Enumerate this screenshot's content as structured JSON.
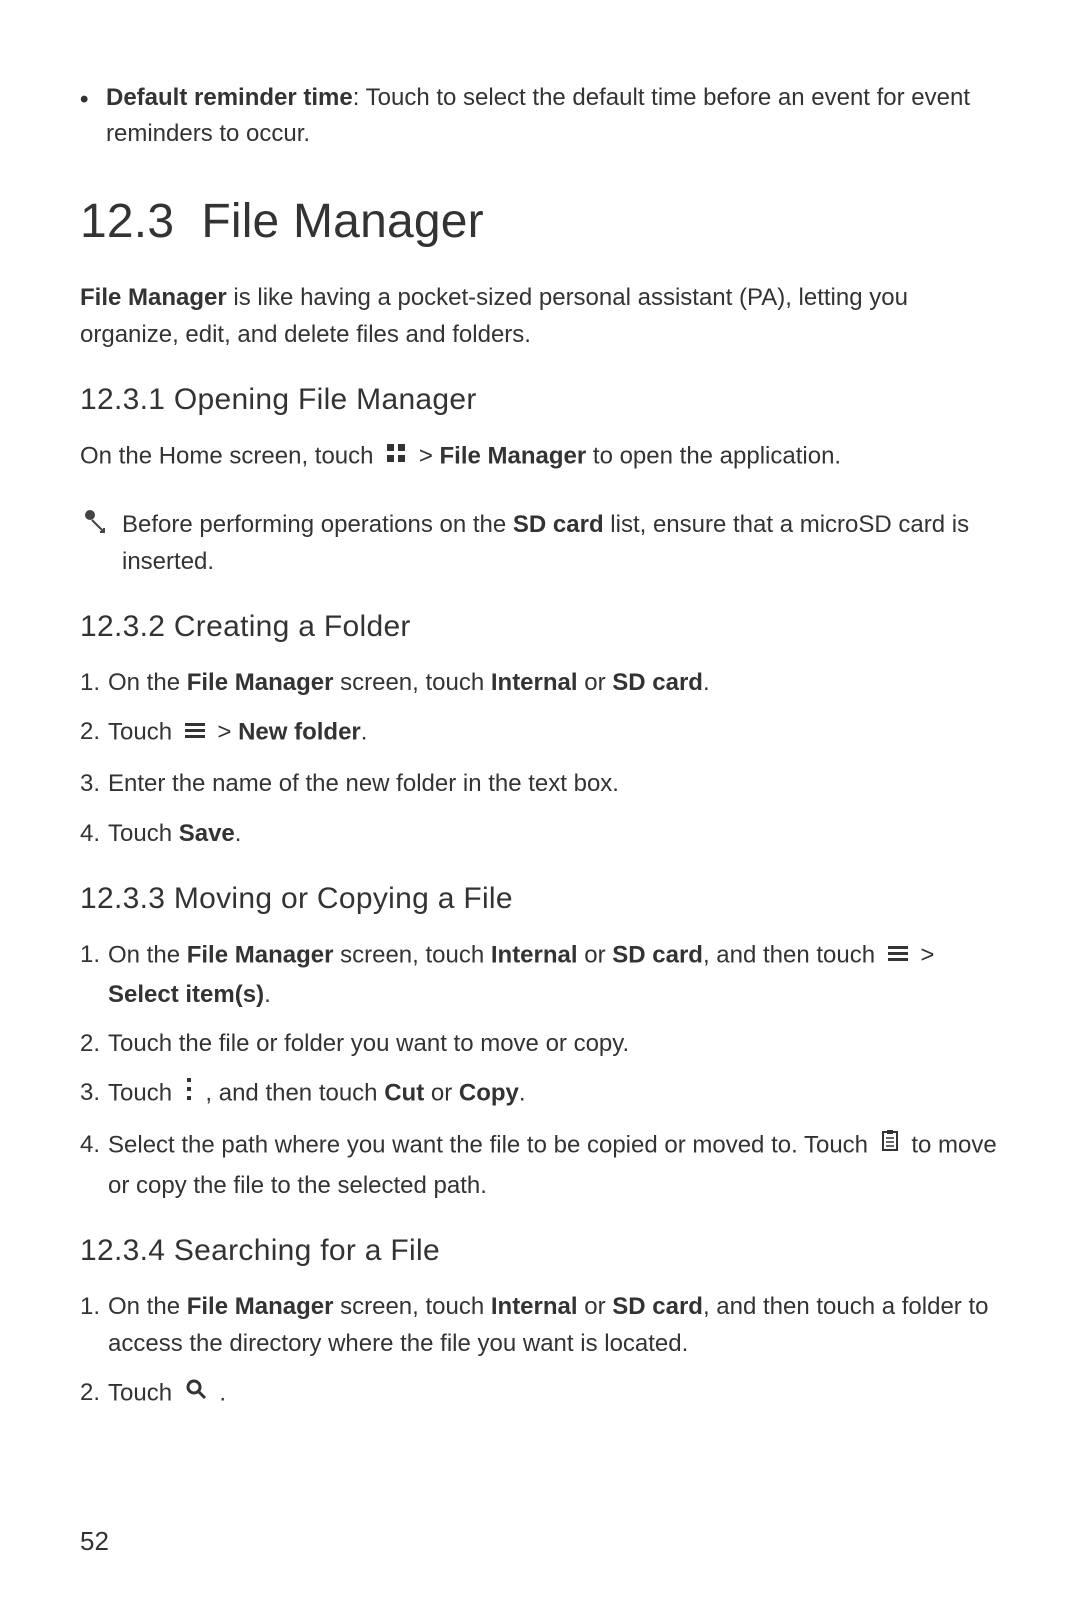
{
  "intro_bullet": {
    "label": "Default reminder time",
    "text": ": Touch to select the default time before an event for event reminders to occur."
  },
  "section": {
    "number": "12.3",
    "title": "File Manager"
  },
  "intro_para": {
    "file_manager": "File Manager",
    "rest": " is like having a pocket-sized personal assistant (PA), letting you organize, edit, and delete files and folders."
  },
  "s1": {
    "heading": "12.3.1  Opening File Manager",
    "line_pre": "On the Home screen, touch ",
    "chevron_post": " > ",
    "file_manager": "File Manager",
    "line_post": " to open the application.",
    "note_pre": "Before performing operations on the ",
    "sd_card": "SD card",
    "note_post": " list, ensure that a microSD card is inserted."
  },
  "s2": {
    "heading": "12.3.2  Creating a Folder",
    "step1_pre": "On the ",
    "fm": "File Manager",
    "step1_mid": " screen, touch ",
    "internal": "Internal",
    "or": " or ",
    "sd": "SD card",
    "step1_post": ".",
    "step2_pre": "Touch ",
    "step2_chev": " > ",
    "new_folder": "New folder",
    "step2_post": ".",
    "step3": "Enter the name of the new folder in the text box.",
    "step4_pre": "Touch ",
    "save": "Save",
    "step4_post": "."
  },
  "s3": {
    "heading": "12.3.3  Moving or Copying a File",
    "step1_pre": "On the ",
    "fm": "File Manager",
    "step1_mid": " screen, touch ",
    "internal": "Internal",
    "or": " or ",
    "sd": "SD card",
    "step1_post1": ", and then touch ",
    "step1_chev": " > ",
    "select_items": "Select item(s)",
    "step1_post2": ".",
    "step2": "Touch the file or folder you want to move or copy.",
    "step3_pre": "Touch ",
    "step3_mid": " , and then touch ",
    "cut": "Cut",
    "or2": " or ",
    "copy": "Copy",
    "step3_post": ".",
    "step4_pre": "Select the path where you want the file to be copied or moved to. Touch ",
    "step4_post": " to move or copy the file to the selected path."
  },
  "s4": {
    "heading": "12.3.4  Searching for a File",
    "step1_pre": "On the ",
    "fm": "File Manager",
    "step1_mid": " screen, touch ",
    "internal": "Internal",
    "or": " or ",
    "sd": "SD card",
    "step1_post": ", and then touch a folder to access the directory where the file you want is located.",
    "step2_pre": "Touch ",
    "step2_post": " ."
  },
  "page_number": "52"
}
